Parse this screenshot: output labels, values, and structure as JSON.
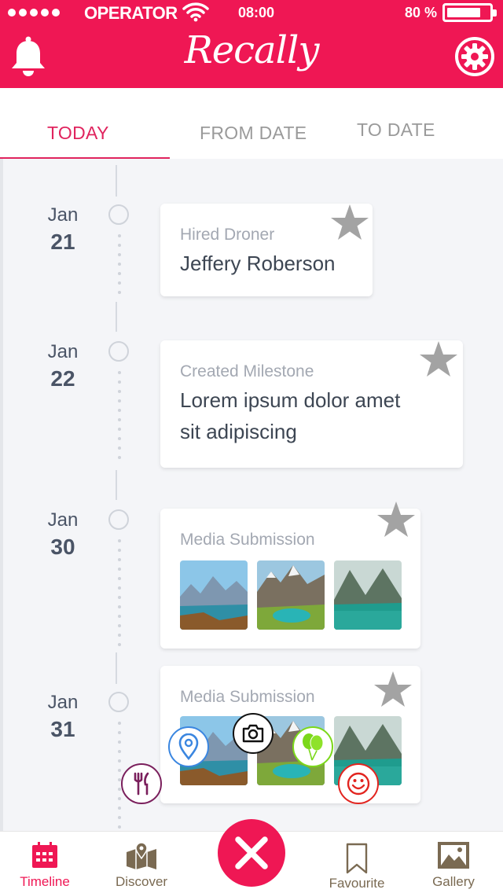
{
  "status_bar": {
    "carrier": "OPERATOR",
    "time": "08:00",
    "battery_percent": "80 %",
    "battery_level": 0.8
  },
  "header": {
    "title": "Recally",
    "left_icon": "bell-icon",
    "right_icon": "gear-icon",
    "background_color": "#ef1754"
  },
  "tabs": [
    {
      "label": "TODAY",
      "active": true
    },
    {
      "label": "FROM DATE",
      "active": false
    },
    {
      "label": "TO DATE",
      "active": false
    }
  ],
  "timeline": [
    {
      "month": "Jan",
      "day": "21",
      "label": "Hired Droner",
      "text": "Jeffery Roberson"
    },
    {
      "month": "Jan",
      "day": "22",
      "label": "Created Milestone",
      "text_line1": "Lorem ipsum dolor amet",
      "text_line2": "sit adipiscing"
    },
    {
      "month": "Jan",
      "day": "30",
      "label": "Media Submission",
      "media_count": 3
    },
    {
      "month": "Jan",
      "day": "31",
      "label": "Media Submission",
      "media_count": 3
    }
  ],
  "floating_actions": [
    {
      "icon": "fork-knife-icon",
      "color": "#7a1f5c"
    },
    {
      "icon": "location-pin-icon",
      "color": "#3a86e0"
    },
    {
      "icon": "camera-icon",
      "color": "#111111"
    },
    {
      "icon": "balloons-icon",
      "color": "#7bd81a"
    },
    {
      "icon": "smiley-icon",
      "color": "#e2241f"
    }
  ],
  "bottom_nav": [
    {
      "label": "Timeline",
      "icon": "calendar-icon",
      "active": true
    },
    {
      "label": "Discover",
      "icon": "map-pin-icon",
      "active": false
    },
    {
      "label": "Favourite",
      "icon": "bookmark-icon",
      "active": false
    },
    {
      "label": "Gallery",
      "icon": "image-icon",
      "active": false
    }
  ],
  "center_button_icon": "close-icon",
  "colors": {
    "accent": "#ef1754",
    "nav_label": "#7a6a52"
  }
}
